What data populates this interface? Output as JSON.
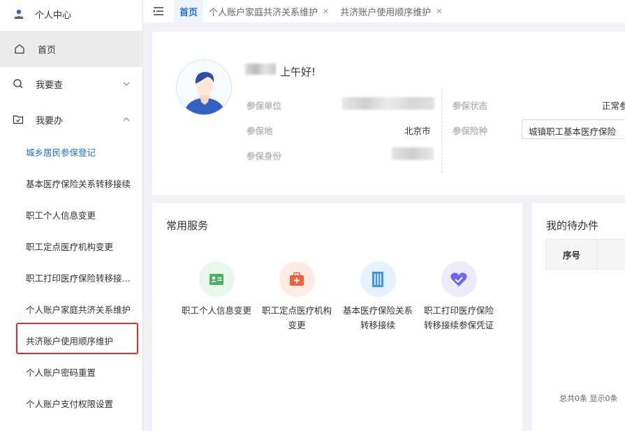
{
  "sidebar": {
    "user_label": "个人中心",
    "home_label": "首页",
    "query_label": "我要查",
    "do_label": "我要办",
    "sub_items": [
      {
        "label": "城乡居民参保登记"
      },
      {
        "label": "基本医疗保险关系转移接续"
      },
      {
        "label": "职工个人信息变更"
      },
      {
        "label": "职工定点医疗机构变更"
      },
      {
        "label": "职工打印医疗保险转移接续参保凭证"
      },
      {
        "label": "个人账户家庭共济关系维护"
      },
      {
        "label": "共济账户使用顺序维护"
      },
      {
        "label": "个人账户密码重置"
      },
      {
        "label": "个人账户支付权限设置"
      }
    ],
    "active_index": 0,
    "highlighted_index": 6
  },
  "tabs": [
    {
      "label": "首页",
      "active": true,
      "closable": false
    },
    {
      "label": "个人账户家庭共济关系维护",
      "active": false,
      "closable": true
    },
    {
      "label": "共济账户使用顺序维护",
      "active": false,
      "closable": true
    }
  ],
  "profile": {
    "greeting": "上午好!",
    "fields": {
      "unit_label": "参保单位",
      "location_label": "参保地",
      "location_value": "北京市",
      "identity_label": "参保身份",
      "status_label": "参保状态",
      "status_value": "正常参",
      "insurance_label": "参保险种",
      "insurance_value": "城镇职工基本医疗保险"
    }
  },
  "services": {
    "title": "常用服务",
    "items": [
      {
        "line1": "职工个人信息变更",
        "line2": "",
        "icon": "id-card-icon",
        "color": "#4caf63",
        "bg": "#e8f6ec"
      },
      {
        "line1": "职工定点医疗机构",
        "line2": "变更",
        "icon": "medical-kit-icon",
        "color": "#f0603d",
        "bg": "#fdece6"
      },
      {
        "line1": "基本医疗保险关系",
        "line2": "转移接续",
        "icon": "building-icon",
        "color": "#3d95ee",
        "bg": "#e6f2fd"
      },
      {
        "line1": "职工打印医疗保险",
        "line2": "转移接续参保凭证",
        "icon": "heart-check-icon",
        "color": "#6c67e8",
        "bg": "#ecebfc"
      }
    ]
  },
  "todo": {
    "title": "我的待办件",
    "col_index": "序号",
    "footer": "总共0条 显示0条"
  },
  "colors": {
    "accent": "#1f6fd6",
    "highlight": "#e5262a"
  }
}
